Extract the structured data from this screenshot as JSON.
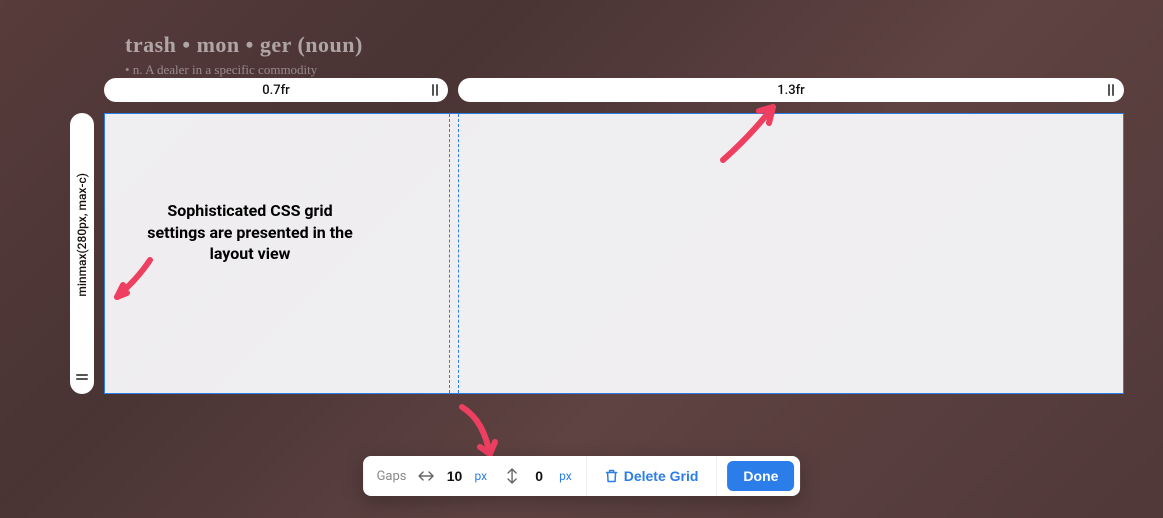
{
  "background": {
    "word_line": "trash • mon • ger (noun)",
    "definition": "• n. A dealer in a specific commodity"
  },
  "columns": [
    {
      "size": "0.7fr"
    },
    {
      "size": "1.3fr"
    }
  ],
  "rows": [
    {
      "size": "minmax(280px, max-c)"
    }
  ],
  "gaps": {
    "label": "Gaps",
    "column": {
      "value": "10",
      "unit": "px"
    },
    "row": {
      "value": "0",
      "unit": "px"
    }
  },
  "toolbar": {
    "delete_label": "Delete Grid",
    "done_label": "Done"
  },
  "annotation": {
    "text": "Sophisticated CSS grid settings are presented in the layout view"
  },
  "colors": {
    "accent": "#2b7de9",
    "arrow": "#ef3f61"
  }
}
